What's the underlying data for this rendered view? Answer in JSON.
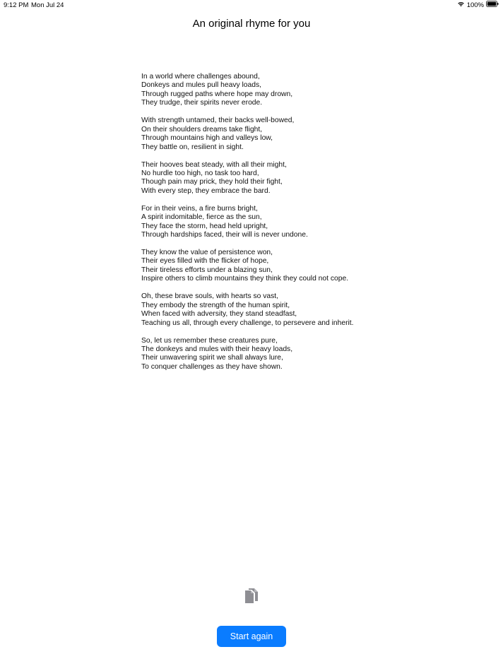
{
  "status_bar": {
    "time": "9:12 PM",
    "date": "Mon Jul 24",
    "battery": "100%",
    "icons": [
      "wifi-icon",
      "battery-icon"
    ]
  },
  "header": {
    "title": "An original rhyme for you"
  },
  "poem": {
    "stanzas": [
      [
        "In a world where challenges abound,",
        "Donkeys and mules pull heavy loads,",
        "Through rugged paths where hope may drown,",
        "They trudge, their spirits never erode."
      ],
      [
        "With strength untamed, their backs well-bowed,",
        "On their shoulders dreams take flight,",
        "Through mountains high and valleys low,",
        "They battle on, resilient in sight."
      ],
      [
        "Their hooves beat steady, with all their might,",
        "No hurdle too high, no task too hard,",
        "Though pain may prick, they hold their fight,",
        "With every step, they embrace the bard."
      ],
      [
        "For in their veins, a fire burns bright,",
        "A spirit indomitable, fierce as the sun,",
        "They face the storm, head held upright,",
        "Through hardships faced, their will is never undone."
      ],
      [
        "They know the value of persistence won,",
        "Their eyes filled with the flicker of hope,",
        "Their tireless efforts under a blazing sun,",
        "Inspire others to climb mountains they think they could not cope."
      ],
      [
        "Oh, these brave souls, with hearts so vast,",
        "They embody the strength of the human spirit,",
        "When faced with adversity, they stand steadfast,",
        "Teaching us all, through every challenge, to persevere and inherit."
      ],
      [
        "So, let us remember these creatures pure,",
        "The donkeys and mules with their heavy loads,",
        "Their unwavering spirit we shall always lure,",
        "To conquer challenges as they have shown."
      ]
    ]
  },
  "actions": {
    "copy_icon": "copy-icon",
    "start_again_label": "Start again"
  },
  "colors": {
    "accent": "#0a7cff",
    "icon_gray": "#8e8e93"
  }
}
